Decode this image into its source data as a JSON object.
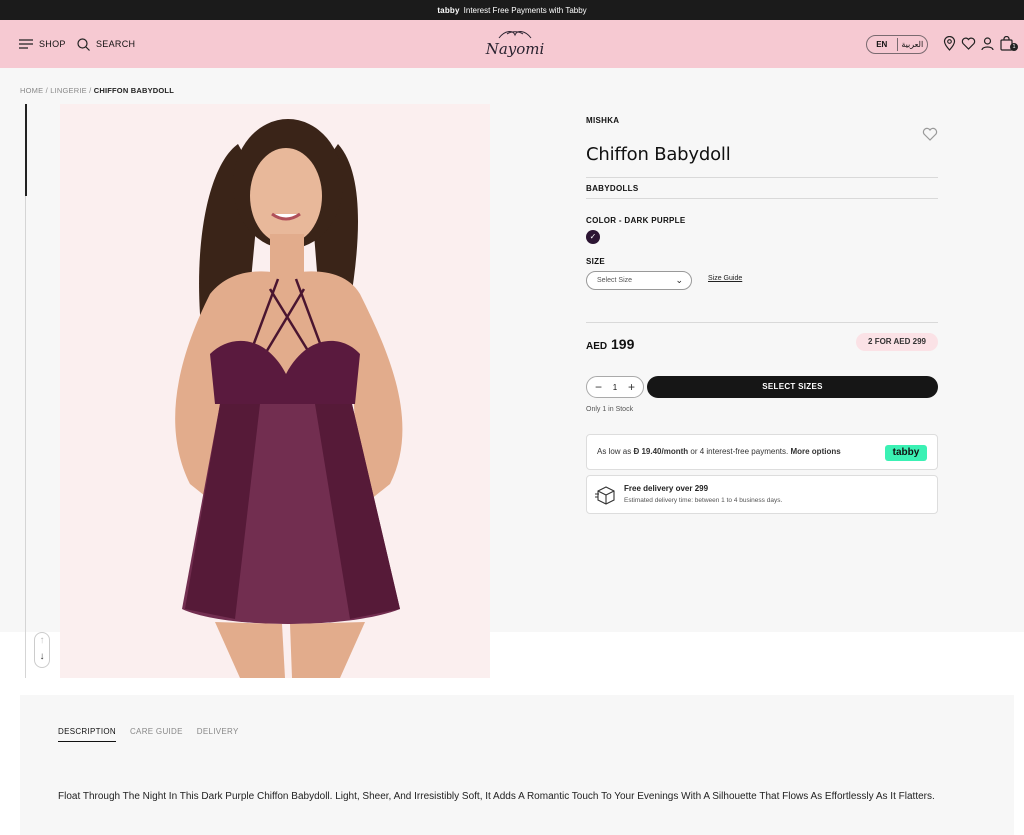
{
  "topbar": {
    "brand": "tabby",
    "message": "Interest Free Payments with Tabby"
  },
  "header": {
    "shop_label": "SHOP",
    "search_label": "SEARCH",
    "logo_text": "Nayomi",
    "lang_en": "EN",
    "lang_ar": "العربية",
    "cart_count": "1"
  },
  "breadcrumb": {
    "home": "HOME",
    "sep1": "/",
    "category": "LINGERIE",
    "sep2": "/",
    "current": "CHIFFON BABYDOLL"
  },
  "product": {
    "brand": "MISHKA",
    "title": "Chiffon Babydoll",
    "category": "BABYDOLLS",
    "color_label": "COLOR - DARK PURPLE",
    "color_hex": "#2c1533",
    "size_label": "SIZE",
    "size_placeholder": "Select Size",
    "size_guide": "Size Guide",
    "currency": "AED",
    "price": "199",
    "promo": "2 FOR AED 299",
    "quantity": "1",
    "select_button": "SELECT SIZES",
    "stock_note": "Only 1 in Stock"
  },
  "tabby": {
    "prefix": "As low as",
    "amount": "Đ 19.40/month",
    "middle": "or 4 interest-free payments.",
    "more": "More options",
    "logo": "tabby",
    "logo_color": "#3bf1b4"
  },
  "delivery": {
    "title": "Free delivery over 299",
    "subtitle": "Estimated delivery time: between 1 to 4 business days."
  },
  "tabs": [
    {
      "label": "DESCRIPTION"
    },
    {
      "label": "CARE GUIDE"
    },
    {
      "label": "DELIVERY"
    }
  ],
  "description": "Float Through The Night In This Dark Purple Chiffon Babydoll. Light, Sheer, And Irresistibly Soft, It Adds A Romantic Touch To Your Evenings With A Silhouette That Flows As Effortlessly As It Flatters.",
  "colors": {
    "header_bg": "#f6c9d2",
    "topbar_bg": "#1b1b1b",
    "button_bg": "#161616",
    "promo_bg": "#fbe2e6"
  }
}
